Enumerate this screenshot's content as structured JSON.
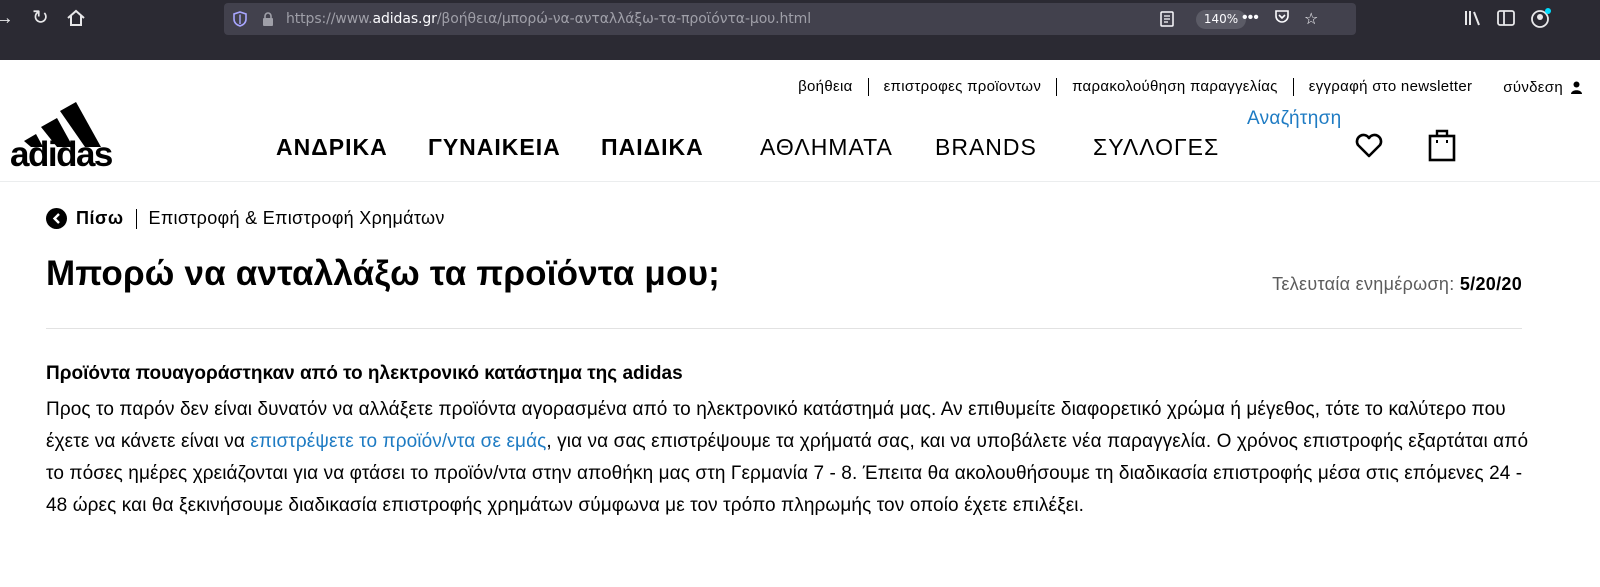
{
  "browser": {
    "url_prefix": "https://www.",
    "url_domain": "adidas.gr",
    "url_path": "/βοήθεια/μπορώ-να-ανταλλάξω-τα-προϊόντα-μου.html",
    "zoom": "140%"
  },
  "utility_nav": {
    "help": "βοήθεια",
    "returns": "επιστροφες προϊοντων",
    "tracking": "παρακολούθηση παραγγελίας",
    "newsletter": "εγγραφή στο newsletter",
    "login": "σύνδεση"
  },
  "logo_text": "adidas",
  "main_nav": {
    "men": "ΑΝΔΡΙΚΑ",
    "women": "ΓΥΝΑΙΚΕΙΑ",
    "kids": "ΠΑΙΔΙΚΑ",
    "sports": "ΑΘΛΗΜΑΤΑ",
    "brands": "BRANDS",
    "collections": "ΣΥΛΛΟΓΕΣ",
    "search": "Αναζήτηση"
  },
  "breadcrumb": {
    "back": "Πίσω",
    "current": "Επιστροφή & Επιστροφή Χρημάτων"
  },
  "article": {
    "title": "Μπορώ να ανταλλάξω τα προϊόντα μου;",
    "updated_label": "Τελευταία ενημέρωση:",
    "updated_date": "5/20/20",
    "section_title": "Προϊόντα πουαγοράστηκαν από το ηλεκτρονικό κατάστημα της adidas",
    "text_before_link": "Προς το παρόν δεν είναι δυνατόν να αλλάξετε προϊόντα αγορασμένα από το ηλεκτρονικό κατάστημά μας. Αν επιθυμείτε διαφορετικό χρώμα ή μέγεθος, τότε το καλύτερο που έχετε να κάνετε είναι να ",
    "link_text": "επιστρέψετε το προϊόν/ντα σε εμάς",
    "text_after_link": ", για να σας επιστρέψουμε τα χρήματά σας, και να υποβάλετε νέα παραγγελία. Ο χρόνος επιστροφής εξαρτάται από το πόσες ημέρες χρειάζονται για να φτάσει το προϊόν/ντα στην αποθήκη μας στη Γερμανία 7 - 8. Έπειτα θα ακολουθήσουμε τη διαδικασία επιστροφής μέσα στις επόμενες 24 - 48 ώρες και θα ξεκινήσουμε διαδικασία επιστροφής χρημάτων σύμφωνα με τον τρόπο πληρωμής τον οποίο έχετε επιλέξει."
  },
  "colors": {
    "link_blue": "#1e7bc3",
    "browser_dark": "#2b2a33"
  }
}
